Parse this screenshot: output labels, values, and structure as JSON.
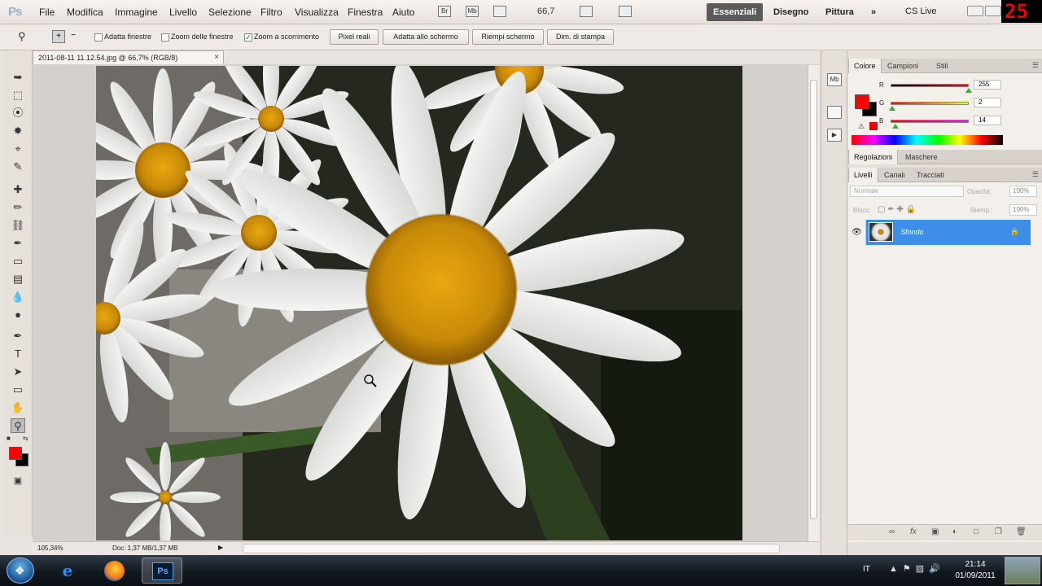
{
  "app": {
    "logo": "Ps",
    "counter": "25"
  },
  "menu": {
    "items": [
      "File",
      "Modifica",
      "Immagine",
      "Livello",
      "Selezione",
      "Filtro",
      "Visualizza",
      "Finestra",
      "Aiuto"
    ],
    "bridge_icon": "Br",
    "minibridge_icon": "Mb",
    "zoom_level": "66,7",
    "workspaces": [
      "Essenziali",
      "Disegno",
      "Pittura"
    ],
    "more": "»",
    "cs_live": "CS Live"
  },
  "options": {
    "checks": [
      {
        "label": "Adatta finestre",
        "checked": false
      },
      {
        "label": "Zoom delle finestre",
        "checked": false
      },
      {
        "label": "Zoom a scorrimento",
        "checked": true
      }
    ],
    "buttons": [
      "Pixel reali",
      "Adatta allo schermo",
      "Riempi schermo",
      "Dim. di stampa"
    ]
  },
  "document": {
    "tab_title": "2011-08-11 11.12.54.jpg @ 66,7% (RGB/8)",
    "tab_close": "×"
  },
  "status": {
    "zoom": "105,34%",
    "doc_info": "Doc: 1,37 MB/1,37 MB",
    "arrow": "▶"
  },
  "panels": {
    "color_tabs": [
      "Colore",
      "Campioni",
      "Stili"
    ],
    "adjust_tabs": [
      "Regolazioni",
      "Maschere"
    ],
    "layer_tabs": [
      "Livelli",
      "Canali",
      "Tracciati"
    ],
    "rgb": [
      {
        "label": "R",
        "value": "255"
      },
      {
        "label": "G",
        "value": "2"
      },
      {
        "label": "B",
        "value": "14"
      }
    ],
    "blend_mode": "Normale",
    "opacity_label": "Opacità:",
    "opacity": "100%",
    "lock_label": "Blocc:",
    "fill_label": "Riemp.:",
    "fill": "100%",
    "layer_name": "Sfondo",
    "footer_icons": [
      "link-icon",
      "fx-icon",
      "mask-icon",
      "adjustment-icon",
      "group-icon",
      "new-layer-icon",
      "trash-icon"
    ]
  },
  "colors": {
    "foreground": "#ff0000",
    "background": "#000000",
    "layer_selected": "#3d8ee8",
    "workspace_active": "#5b5b5b"
  },
  "taskbar": {
    "lang": "IT",
    "time": "21:14",
    "date": "01/09/2011",
    "ps_label": "Ps"
  }
}
